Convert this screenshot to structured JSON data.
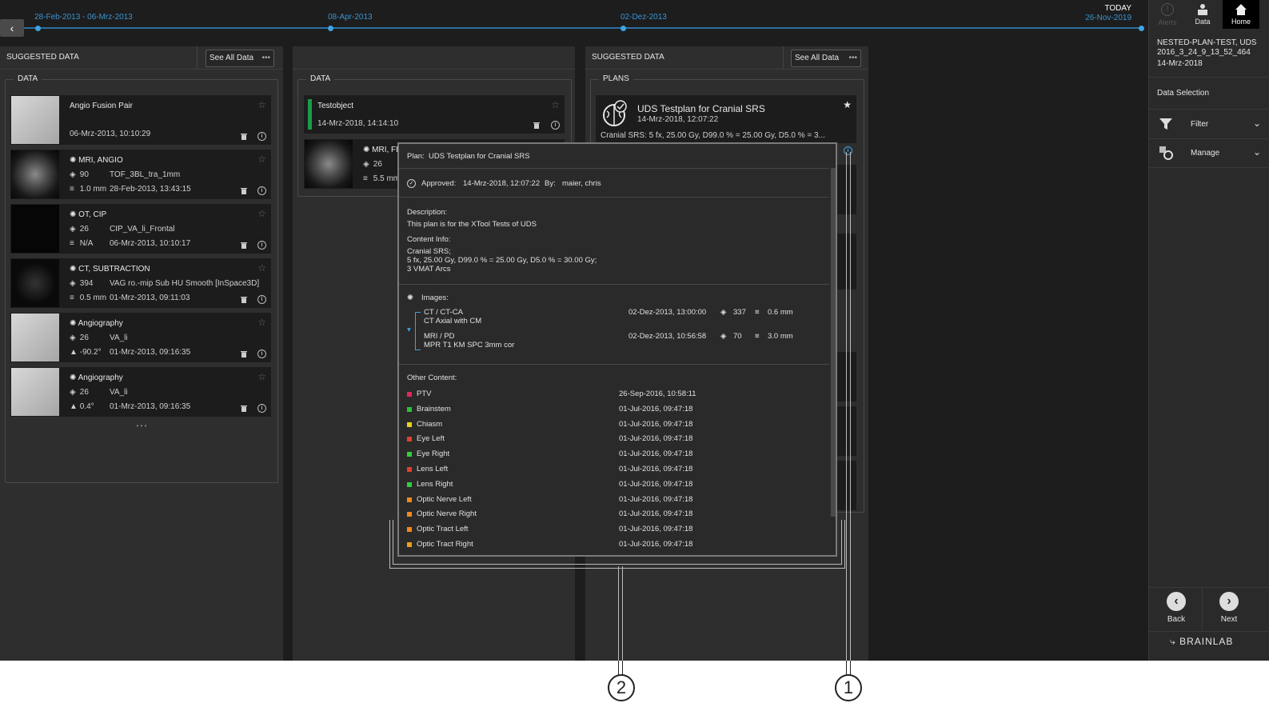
{
  "timeline": {
    "dates": [
      "28-Feb-2013 - 06-Mrz-2013",
      "08-Apr-2013",
      "02-Dez-2013"
    ],
    "today_label": "TODAY",
    "today_date": "26-Nov-2019"
  },
  "topbar": {
    "alerts": "Alerts",
    "data": "Data",
    "home": "Home"
  },
  "sidebar": {
    "patient_line1": "NESTED-PLAN-TEST, UDS",
    "patient_line2": "2016_3_24_9_13_52_464",
    "patient_line3": "14-Mrz-2018",
    "data_selection": "Data Selection",
    "filter": "Filter",
    "manage": "Manage",
    "back": "Back",
    "next": "Next",
    "brand": "BRAINLAB"
  },
  "col1": {
    "header": "SUGGESTED DATA",
    "see_all": "See All Data",
    "group_title": "DATA",
    "cards": [
      {
        "title": "Angio Fusion Pair",
        "line2": "",
        "line3": "06-Mrz-2013, 10:10:29"
      },
      {
        "title": "MRI, ANGIO",
        "count": "90",
        "name": "TOF_3BL_tra_1mm",
        "spacing": "1.0 mm",
        "date": "28-Feb-2013, 13:43:15"
      },
      {
        "title": "OT, CIP",
        "count": "26",
        "name": "CIP_VA_li_Frontal",
        "spacing": "N/A",
        "date": "06-Mrz-2013, 10:10:17"
      },
      {
        "title": "CT, SUBTRACTION",
        "count": "394",
        "name": "VAG ro.-mip Sub HU Smooth [InSpace3D]",
        "spacing": "0.5 mm",
        "date": "01-Mrz-2013, 09:11:03"
      },
      {
        "title": "Angiography",
        "count": "26",
        "name": "VA_li",
        "spacing": "-90.2°",
        "date": "01-Mrz-2013, 09:16:35"
      },
      {
        "title": "Angiography",
        "count": "26",
        "name": "VA_li",
        "spacing": "0.4°",
        "date": "01-Mrz-2013, 09:16:35"
      }
    ],
    "more": "• • •"
  },
  "col2": {
    "group_title": "DATA",
    "card1_title": "Testobject",
    "card1_date": "14-Mrz-2018, 14:14:10",
    "card2_title": "MRI, FL",
    "card2_count": "26",
    "card2_spacing": "5.5 mm"
  },
  "col3": {
    "header": "SUGGESTED DATA",
    "see_all": "See All Data",
    "group_title": "PLANS",
    "plan_title": "UDS Testplan for Cranial SRS",
    "plan_date": "14-Mrz-2018, 12:07:22",
    "plan_summary": "Cranial SRS: 5 fx, 25.00 Gy, D99.0 % = 25.00 Gy, D5.0 % = 3..."
  },
  "popup": {
    "plan_label": "Plan:",
    "plan_name": "UDS Testplan for Cranial SRS",
    "approved_label": "Approved:",
    "approved_date": "14-Mrz-2018, 12:07:22",
    "by_label": "By:",
    "by_name": "maier, chris",
    "description_label": "Description:",
    "description": "This plan is for the XTool Tests of UDS",
    "content_info_label": "Content Info:",
    "content_info_1": "Cranial SRS;",
    "content_info_2": "5 fx, 25.00 Gy, D99.0 % = 25.00 Gy, D5.0 % = 30.00 Gy;",
    "content_info_3": "3 VMAT Arcs",
    "images_label": "Images:",
    "images": [
      {
        "type": "CT / CT-CA",
        "desc": "CT Axial with CM",
        "date": "02-Dez-2013, 13:00:00",
        "count": "337",
        "spacing": "0.6 mm"
      },
      {
        "type": "MRI / PD",
        "desc": "MPR T1 KM SPC 3mm cor",
        "date": "02-Dez-2013, 10:56:58",
        "count": "70",
        "spacing": "3.0 mm"
      }
    ],
    "other_label": "Other Content:",
    "other": [
      {
        "name": "PTV",
        "date": "26-Sep-2016, 10:58:11",
        "color": "#e0285a"
      },
      {
        "name": "Brainstem",
        "date": "01-Jul-2016, 09:47:18",
        "color": "#2fbf3c"
      },
      {
        "name": "Chiasm",
        "date": "01-Jul-2016, 09:47:18",
        "color": "#e8d21c"
      },
      {
        "name": "Eye Left",
        "date": "01-Jul-2016, 09:47:18",
        "color": "#e0402c"
      },
      {
        "name": "Eye Right",
        "date": "01-Jul-2016, 09:47:18",
        "color": "#2fcf3c"
      },
      {
        "name": "Lens Left",
        "date": "01-Jul-2016, 09:47:18",
        "color": "#e0402c"
      },
      {
        "name": "Lens Right",
        "date": "01-Jul-2016, 09:47:18",
        "color": "#2fcf3c"
      },
      {
        "name": "Optic Nerve Left",
        "date": "01-Jul-2016, 09:47:18",
        "color": "#f08a1c"
      },
      {
        "name": "Optic Nerve Right",
        "date": "01-Jul-2016, 09:47:18",
        "color": "#f08a1c"
      },
      {
        "name": "Optic Tract Left",
        "date": "01-Jul-2016, 09:47:18",
        "color": "#f08a1c"
      },
      {
        "name": "Optic Tract Right",
        "date": "01-Jul-2016, 09:47:18",
        "color": "#e8a01c"
      }
    ]
  },
  "callouts": {
    "one": "1",
    "two": "2"
  }
}
